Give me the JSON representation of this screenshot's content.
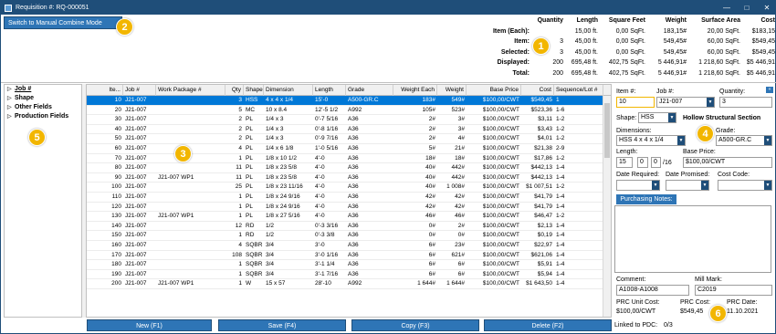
{
  "window": {
    "title": "Requisition #: RQ-000051"
  },
  "toolbar": {
    "switch_label": "Switch to Manual Combine Mode"
  },
  "summary": {
    "headers": [
      "Quantity",
      "Length",
      "Square Feet",
      "Weight",
      "Surface Area",
      "Cost"
    ],
    "rows": [
      {
        "label": "Item (Each):",
        "values": [
          "",
          "15,00 ft.",
          "0,00 SqFt.",
          "183,15#",
          "20,00 SqFt.",
          "$183,15"
        ]
      },
      {
        "label": "Item:",
        "values": [
          "3",
          "45,00 ft.",
          "0,00 SqFt.",
          "549,45#",
          "60,00 SqFt.",
          "$549,45"
        ]
      },
      {
        "label": "Selected:",
        "values": [
          "3",
          "45,00 ft.",
          "0,00 SqFt.",
          "549,45#",
          "60,00 SqFt.",
          "$549,45"
        ]
      },
      {
        "label": "Displayed:",
        "values": [
          "200",
          "695,48 ft.",
          "402,75 SqFt.",
          "5 446,91#",
          "1 218,60 SqFt.",
          "$5 446,91"
        ]
      },
      {
        "label": "Total:",
        "values": [
          "200",
          "695,48 ft.",
          "402,75 SqFt.",
          "5 446,91#",
          "1 218,60 SqFt.",
          "$5 446,91"
        ]
      }
    ]
  },
  "tree": {
    "items": [
      "Job #",
      "Shape",
      "Other Fields",
      "Production Fields"
    ]
  },
  "grid": {
    "headers": [
      "Ite...",
      "Job #",
      "Work Package #",
      "Qty",
      "Shape",
      "Dimension",
      "Length",
      "Grade",
      "Weight Each",
      "Weight",
      "Base Price",
      "Cost",
      "Sequence/Lot #"
    ],
    "rows": [
      [
        "10",
        "J21-007",
        "",
        "3",
        "HSS",
        "4 x 4 x 1/4",
        "15'-0",
        "A500-GR.C",
        "183#",
        "549#",
        "$100,00/CWT",
        "$549,45",
        "1"
      ],
      [
        "20",
        "J21-007",
        "",
        "5",
        "MC",
        "10 x 8.4",
        "12'-5 1/2",
        "A992",
        "105#",
        "523#",
        "$100,00/CWT",
        "$523,36",
        "1-6"
      ],
      [
        "30",
        "J21-007",
        "",
        "2",
        "PL",
        "1/4 x 3",
        "0'-7 5/16",
        "A36",
        "2#",
        "3#",
        "$100,00/CWT",
        "$3,11",
        "1-2"
      ],
      [
        "40",
        "J21-007",
        "",
        "2",
        "PL",
        "1/4 x 3",
        "0'-8 1/16",
        "A36",
        "2#",
        "3#",
        "$100,00/CWT",
        "$3,43",
        "1-2"
      ],
      [
        "50",
        "J21-007",
        "",
        "2",
        "PL",
        "1/4 x 3",
        "0'-9 7/16",
        "A36",
        "2#",
        "4#",
        "$100,00/CWT",
        "$4,01",
        "1-2"
      ],
      [
        "60",
        "J21-007",
        "",
        "4",
        "PL",
        "1/4 x 6 1/8",
        "1'-0 5/16",
        "A36",
        "5#",
        "21#",
        "$100,00/CWT",
        "$21,38",
        "2-9"
      ],
      [
        "70",
        "J21-007",
        "",
        "1",
        "PL",
        "1/8 x 10 1/2",
        "4'-0",
        "A36",
        "18#",
        "18#",
        "$100,00/CWT",
        "$17,86",
        "1-2"
      ],
      [
        "80",
        "J21-007",
        "",
        "11",
        "PL",
        "1/8 x 23 5/8",
        "4'-0",
        "A36",
        "40#",
        "442#",
        "$100,00/CWT",
        "$442,13",
        "1-4"
      ],
      [
        "90",
        "J21-007",
        "J21-007 WP1",
        "11",
        "PL",
        "1/8 x 23 5/8",
        "4'-0",
        "A36",
        "40#",
        "442#",
        "$100,00/CWT",
        "$442,13",
        "1-4"
      ],
      [
        "100",
        "J21-007",
        "",
        "25",
        "PL",
        "1/8 x 23 11/16",
        "4'-0",
        "A36",
        "40#",
        "1 008#",
        "$100,00/CWT",
        "$1 007,51",
        "1-2"
      ],
      [
        "110",
        "J21-007",
        "",
        "1",
        "PL",
        "1/8 x 24 9/16",
        "4'-0",
        "A36",
        "42#",
        "42#",
        "$100,00/CWT",
        "$41,79",
        "1-4"
      ],
      [
        "120",
        "J21-007",
        "",
        "1",
        "PL",
        "1/8 x 24 9/16",
        "4'-0",
        "A36",
        "42#",
        "42#",
        "$100,00/CWT",
        "$41,79",
        "1-4"
      ],
      [
        "130",
        "J21-007",
        "J21-007 WP1",
        "1",
        "PL",
        "1/8 x 27 5/16",
        "4'-0",
        "A36",
        "46#",
        "46#",
        "$100,00/CWT",
        "$46,47",
        "1-2"
      ],
      [
        "140",
        "J21-007",
        "",
        "12",
        "RD",
        "1/2",
        "0'-3 3/16",
        "A36",
        "0#",
        "2#",
        "$100,00/CWT",
        "$2,13",
        "1-4"
      ],
      [
        "150",
        "J21-007",
        "",
        "1",
        "RD",
        "1/2",
        "0'-3 3/8",
        "A36",
        "0#",
        "0#",
        "$100,00/CWT",
        "$0,19",
        "1-4"
      ],
      [
        "160",
        "J21-007",
        "",
        "4",
        "SQBR",
        "3/4",
        "3'-0",
        "A36",
        "6#",
        "23#",
        "$100,00/CWT",
        "$22,97",
        "1-4"
      ],
      [
        "170",
        "J21-007",
        "",
        "108",
        "SQBR",
        "3/4",
        "3'-0 1/16",
        "A36",
        "6#",
        "621#",
        "$100,00/CWT",
        "$621,06",
        "1-4"
      ],
      [
        "180",
        "J21-007",
        "",
        "1",
        "SQBR",
        "3/4",
        "3'-1 1/4",
        "A36",
        "6#",
        "6#",
        "$100,00/CWT",
        "$5,91",
        "1-4"
      ],
      [
        "190",
        "J21-007",
        "",
        "1",
        "SQBR",
        "3/4",
        "3'-1 7/16",
        "A36",
        "6#",
        "6#",
        "$100,00/CWT",
        "$5,94",
        "1-4"
      ],
      [
        "200",
        "J21-007",
        "J21-007 WP1",
        "1",
        "W",
        "15 x 57",
        "28'-10",
        "A992",
        "1 644#",
        "1 644#",
        "$100,00/CWT",
        "$1 643,50",
        "1-4"
      ]
    ]
  },
  "actions": {
    "new": "New (F1)",
    "save": "Save (F4)",
    "copy": "Copy (F3)",
    "delete": "Delete (F2)"
  },
  "detail": {
    "item_label": "Item #:",
    "item_value": "10",
    "job_label": "Job #:",
    "job_value": "J21-007",
    "qty_label": "Quantity:",
    "qty_value": "3",
    "shape_label": "Shape:",
    "shape_value": "HSS",
    "shape_desc": "Hollow Structural Section",
    "dim_label": "Dimensions:",
    "dim_value": "HSS 4 x 4 x 1/4",
    "grade_label": "Grade:",
    "grade_value": "A500-GR.C",
    "length_label": "Length:",
    "len_ft": "15",
    "len_in": "0",
    "len_num": "0",
    "len_den": "/16",
    "base_label": "Base Price:",
    "base_value": "$100,00/CWT",
    "date_req_label": "Date Required:",
    "date_prom_label": "Date Promised:",
    "cost_code_label": "Cost Code:",
    "notes_label": "Purchasing Notes:",
    "comment_label": "Comment:",
    "comment_value": "A1008-A1008",
    "mill_label": "Mill Mark:",
    "mill_value": "C2019",
    "prc_unit_label": "PRC Unit Cost:",
    "prc_unit_value": "$100,00/CWT",
    "prc_cost_label": "PRC Cost:",
    "prc_cost_value": "$549,45",
    "prc_date_label": "PRC Date:",
    "prc_date_value": "11.10.2021",
    "linked_label": "Linked to PDC:",
    "linked_value": "0/3"
  },
  "callouts": [
    "1",
    "2",
    "3",
    "4",
    "5",
    "6"
  ],
  "colors": {
    "titlebar": "#1f4e79",
    "button": "#2e75b6",
    "selected": "#0078d7",
    "callout": "#f2b600"
  }
}
